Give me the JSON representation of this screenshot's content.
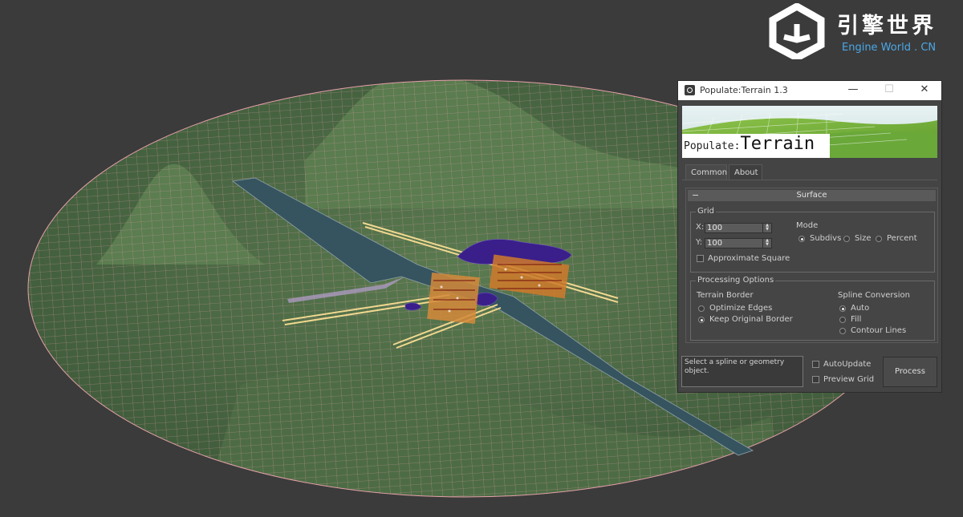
{
  "watermark": {
    "brand_cn": "引擎世界",
    "brand_en": "Engine World . CN"
  },
  "window": {
    "title": "Populate:Terrain 1.3",
    "controls": {
      "minimize": "—",
      "maximize": "☐",
      "close": "✕"
    }
  },
  "banner": {
    "prefix": "Populate:",
    "name": "Terrain"
  },
  "tabs": [
    {
      "label": "Common",
      "active": true
    },
    {
      "label": "About",
      "active": false
    }
  ],
  "surface": {
    "rollout_title": "Surface",
    "collapse_symbol": "−",
    "grid": {
      "group_label": "Grid",
      "x_label": "X:",
      "x_value": "100",
      "y_label": "Y:",
      "y_value": "100",
      "approx_square_label": "Approximate Square",
      "approx_square_checked": false,
      "mode_label": "Mode",
      "mode_options": [
        "Subdivs",
        "Size",
        "Percent"
      ],
      "mode_selected": "Subdivs"
    },
    "processing": {
      "group_label": "Processing Options",
      "terrain_border_label": "Terrain Border",
      "terrain_border_options": [
        "Optimize Edges",
        "Keep Original Border"
      ],
      "terrain_border_selected": "Keep Original Border",
      "spline_conversion_label": "Spline Conversion",
      "spline_options": [
        "Auto",
        "Fill",
        "Contour Lines"
      ],
      "spline_selected": "Auto"
    }
  },
  "footer": {
    "status_text": "Select a spline or geometry object.",
    "auto_update_label": "AutoUpdate",
    "auto_update_checked": false,
    "preview_grid_label": "Preview Grid",
    "preview_grid_checked": false,
    "process_label": "Process"
  },
  "colors": {
    "viewport_bg": "#3b3b3b",
    "terrain": "#4a6a44",
    "wire": "#e7a0aa",
    "road": "#35545f",
    "buildings": "#d07a2a",
    "trees": "#3a1f8a",
    "accent_blue": "#4aa8e8"
  }
}
